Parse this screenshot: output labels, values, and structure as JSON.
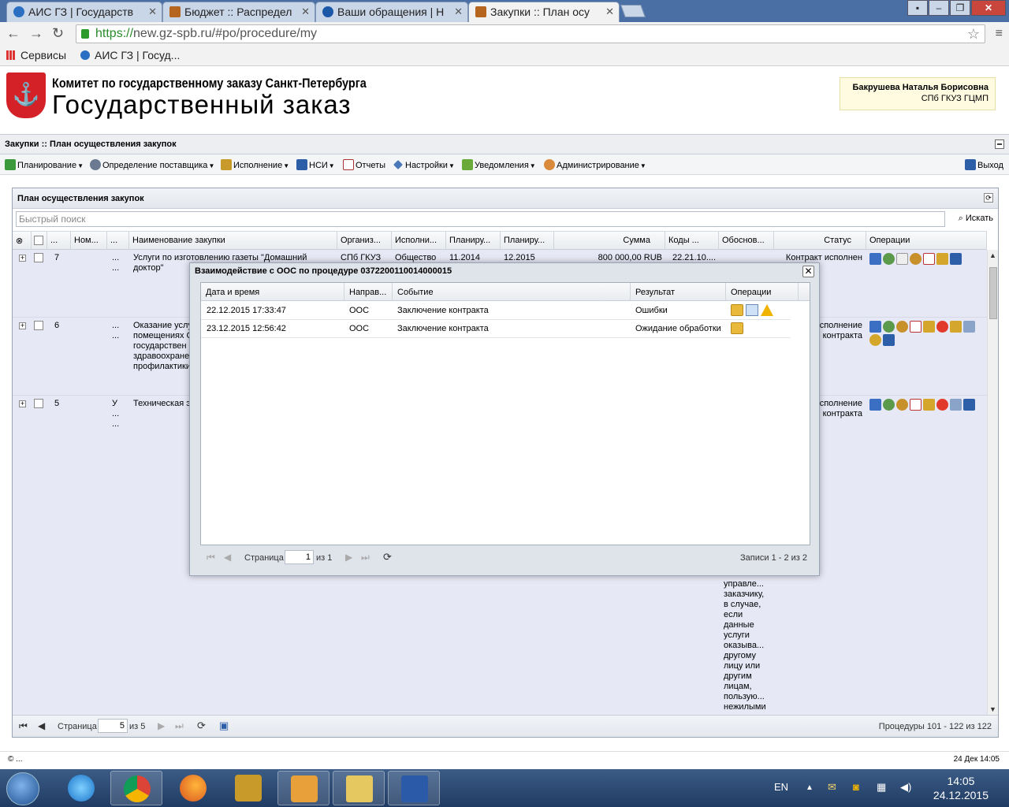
{
  "browser": {
    "tabs": [
      {
        "label": "АИС ГЗ | Государств"
      },
      {
        "label": "Бюджет :: Распредел"
      },
      {
        "label": "Ваши обращения | Н"
      },
      {
        "label": "Закупки :: План осу"
      }
    ],
    "url_scheme": "https://",
    "url_rest": "new.gz-spb.ru/#po/procedure/my",
    "bookmarks": {
      "apps": "Сервисы",
      "item1": "АИС ГЗ | Госуд..."
    }
  },
  "header": {
    "committee": "Комитет по государственному заказу Санкт-Петербурга",
    "title": "Государственный заказ",
    "user_name": "Бакрушева Наталья Борисовна",
    "user_org": "СПб ГКУЗ ГЦМП"
  },
  "page_title": "Закупки :: План осуществления закупок",
  "menu": {
    "planning": "Планирование",
    "supplier": "Определение поставщика",
    "execution": "Исполнение",
    "nsi": "НСИ",
    "reports": "Отчеты",
    "settings": "Настройки",
    "notifications": "Уведомления",
    "admin": "Администрирование",
    "exit": "Выход"
  },
  "panel": {
    "title": "План осуществления закупок",
    "search_placeholder": "Быстрый поиск",
    "search_button": "Искать"
  },
  "grid": {
    "columns": [
      "...",
      "Ном...",
      "...",
      "Наименование закупки",
      "Организ...",
      "Исполни...",
      "Планиру...",
      "Планиру...",
      "Сумма",
      "Коды ...",
      "Обоснов...",
      "Статус",
      "Операции"
    ],
    "rows": [
      {
        "num": "7",
        "col3": "...\n...",
        "name": "Услуги по изготовлению газеты \"Домашний доктор\"",
        "org": "СПб ГКУЗ",
        "executor": "Общество",
        "plan1": "11.2014",
        "plan2": "12.2015",
        "sum": "800 000,00 RUB",
        "codes": "22.21.10....",
        "justification": "",
        "status": "Контракт исполнен"
      },
      {
        "num": "6",
        "col3": "...\n...",
        "name": "Оказание услу\nпомещениях С\nгосударствен\nздравоохране\nпрофилактики",
        "org": "",
        "executor": "",
        "plan1": "",
        "plan2": "",
        "sum": "",
        "codes": "",
        "justification": "",
        "status": "сполнение\nконтракта"
      },
      {
        "num": "5",
        "col3": "У\n...\n...",
        "name": "Техническая э",
        "org": "",
        "executor": "",
        "plan1": "",
        "plan2": "",
        "sum": "",
        "codes": "",
        "justification": "управле...\nзаказчику,\nв случае,\nесли\nданные\nуслуги\nоказыва...\nдругому\nлицу или\nдругим\nлицам,\nпользую...\nнежилыми\nпомещен...",
        "status": "сполнение\nконтракта"
      }
    ]
  },
  "pager": {
    "page_label": "Страница",
    "page": "5",
    "of": "из 5",
    "records": "Процедуры 101 - 122 из 122"
  },
  "modal": {
    "title": "Взаимодействие с ООС по процедуре 0372200110014000015",
    "columns": [
      "Дата и время",
      "Направ...",
      "Событие",
      "Результат",
      "Операции"
    ],
    "rows": [
      {
        "datetime": "22.12.2015 17:33:47",
        "direction": "ООС",
        "event": "Заключение контракта",
        "result": "Ошибки"
      },
      {
        "datetime": "23.12.2015 12:56:42",
        "direction": "ООС",
        "event": "Заключение контракта",
        "result": "Ожидание обработки"
      }
    ],
    "pager": {
      "page_label": "Страница",
      "page": "1",
      "of": "из 1",
      "records": "Записи 1 - 2 из 2"
    }
  },
  "footer": {
    "left": "© ...",
    "right": "24 Дек 14:05"
  },
  "taskbar": {
    "lang": "EN",
    "time": "14:05",
    "date": "24.12.2015"
  }
}
